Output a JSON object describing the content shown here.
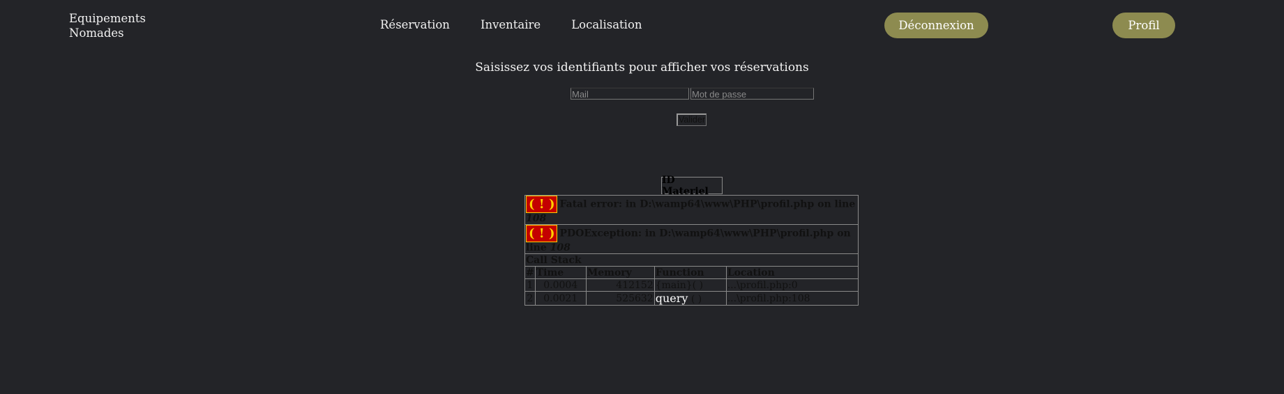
{
  "header": {
    "brand_line1": "Equipements",
    "brand_line2": "Nomades",
    "nav": [
      "Réservation",
      "Inventaire",
      "Localisation"
    ],
    "logout_label": "Déconnexion",
    "profile_label": "Profil"
  },
  "login": {
    "prompt": "Saisissez vos identifiants pour afficher vos réservations",
    "mail_placeholder": "Mail",
    "password_placeholder": "Mot de passe",
    "submit_label": "Valider"
  },
  "result": {
    "column_header": "ID Materiel"
  },
  "error": {
    "icon": "( ! )",
    "fatal_prefix": "Fatal error: in D:\\wamp64\\www\\PHP\\profil.php on line ",
    "fatal_line": "108",
    "exception_prefix": "PDOException: in D:\\wamp64\\www\\PHP\\profil.php on line ",
    "exception_line": "108",
    "call_stack_label": "Call Stack",
    "columns": [
      "#",
      "Time",
      "Memory",
      "Function",
      "Location"
    ],
    "rows": [
      {
        "n": "1",
        "time": "0.0004",
        "memory": "412152",
        "function": "{main}( )",
        "location": "...\\profil.php:0"
      },
      {
        "n": "2",
        "time": "0.0021",
        "memory": "525632",
        "function_name": "query",
        "function_args": " ( )",
        "location": "...\\profil.php:108"
      }
    ]
  },
  "colors": {
    "background": "#232428",
    "accent": "#8d8b50",
    "error_red": "#c40000",
    "error_yellow": "#ffd200"
  }
}
